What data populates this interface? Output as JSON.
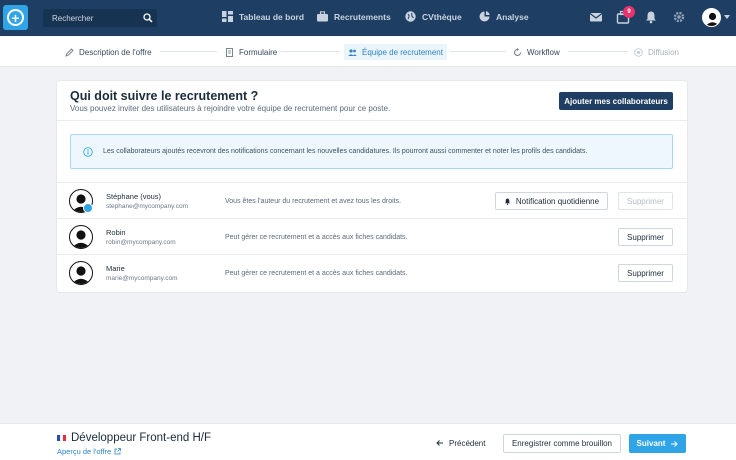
{
  "topnav": {
    "search_placeholder": "Rechercher",
    "items": [
      {
        "label": "Tableau de bord",
        "icon": "dashboard-icon"
      },
      {
        "label": "Recrutements",
        "icon": "briefcase-icon"
      },
      {
        "label": "CVthèque",
        "icon": "globe-icon"
      },
      {
        "label": "Analyse",
        "icon": "chart-icon"
      }
    ],
    "notification_count": "9",
    "accent_color": "#2fa4e7",
    "bar_color": "#1f3e63"
  },
  "steps": [
    {
      "label": "Description de l'offre",
      "icon": "pen-icon",
      "state": "done"
    },
    {
      "label": "Formulaire",
      "icon": "form-icon",
      "state": "done"
    },
    {
      "label": "Équipe de recrutement",
      "icon": "team-icon",
      "state": "active"
    },
    {
      "label": "Workflow",
      "icon": "workflow-icon",
      "state": "done"
    },
    {
      "label": "Diffusion",
      "icon": "broadcast-icon",
      "state": "disabled"
    }
  ],
  "card": {
    "title": "Qui doit suivre le recrutement ?",
    "subtitle": "Vous pouvez inviter des utilisateurs à rejoindre votre équipe de recrutement pour ce poste.",
    "add_button": "Ajouter mes collaborateurs",
    "info_text": "Les collaborateurs ajoutés recevront des notifications concernant les nouvelles candidatures. Ils pourront aussi commenter et noter les profils des candidats."
  },
  "members": [
    {
      "name": "Stéphane (vous)",
      "email": "stephane@mycompany.com",
      "description": "Vous êtes l'auteur du recrutement et avez tous les droits.",
      "notif_button": "Notification quotidienne",
      "delete_button": "Supprimer",
      "delete_disabled": true
    },
    {
      "name": "Robin",
      "email": "robin@mycompany.com",
      "description": "Peut gérer ce recrutement et a accès aux fiches candidats.",
      "delete_button": "Supprimer",
      "delete_disabled": false
    },
    {
      "name": "Marie",
      "email": "marie@mycompany.com",
      "description": "Peut gérer ce recrutement et a accès aux fiches candidats.",
      "delete_button": "Supprimer",
      "delete_disabled": false
    }
  ],
  "footer": {
    "job_title": "Développeur Front-end H/F",
    "preview_link": "Aperçu de l'offre",
    "prev_button": "Précédent",
    "draft_button": "Enregistrer comme brouillon",
    "next_button": "Suivant"
  }
}
